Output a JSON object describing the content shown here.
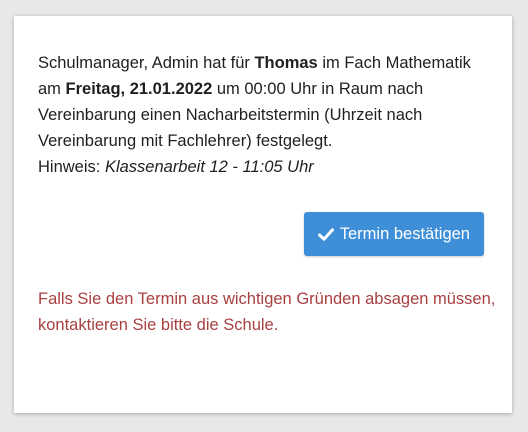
{
  "message": {
    "part1": "Schulmanager, Admin hat für ",
    "student": "Thomas",
    "part2": " im Fach Mathematik am ",
    "date": "Freitag, 21.01.2022",
    "part3": " um 00:00 Uhr in Raum nach Vereinbarung einen Nacharbeitstermin (Uhrzeit nach Vereinbarung mit Fachlehrer) festgelegt."
  },
  "hint": {
    "label": "Hinweis: ",
    "text": "Klassenarbeit 12 - 11:05 Uhr"
  },
  "button": {
    "icon": "checkmark-icon",
    "label": "Termin bestätigen"
  },
  "warning": "Falls Sie den Termin aus wichtigen Gründen absagen müssen, kontaktieren Sie bitte die Schule.",
  "colors": {
    "button_bg": "#3f8fd8",
    "warning_text": "#a94040",
    "body_text": "#1f1f1f"
  }
}
